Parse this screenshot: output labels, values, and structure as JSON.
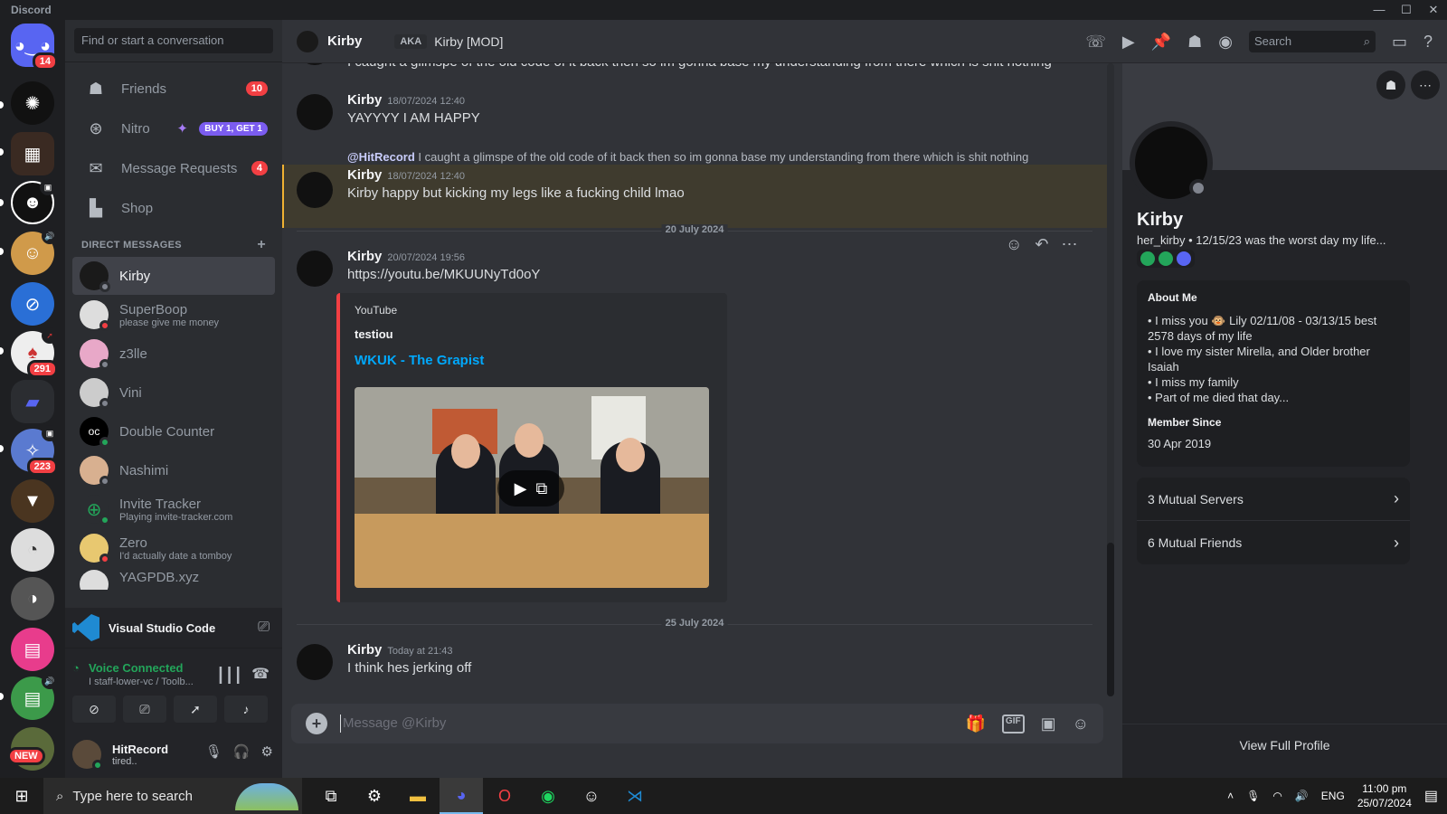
{
  "app": {
    "title": "Discord",
    "window_controls": [
      "—",
      "☐",
      "✕"
    ]
  },
  "servers": {
    "home_badge": "14",
    "badge_291": "291",
    "badge_223": "223",
    "new_label": "NEW"
  },
  "dm_sidebar": {
    "search_placeholder": "Find or start a conversation",
    "nav": [
      {
        "label": "Friends",
        "count": "10"
      },
      {
        "label": "Nitro",
        "promo": "BUY 1, GET 1"
      },
      {
        "label": "Message Requests",
        "count": "4"
      },
      {
        "label": "Shop"
      }
    ],
    "section_title": "DIRECT MESSAGES",
    "add": "+",
    "dms": [
      {
        "name": "Kirby",
        "status": ""
      },
      {
        "name": "SuperBoop",
        "status": "please give me money"
      },
      {
        "name": "z3lle",
        "status": ""
      },
      {
        "name": "Vini",
        "status": ""
      },
      {
        "name": "Double Counter",
        "status": ""
      },
      {
        "name": "Nashimi",
        "status": ""
      },
      {
        "name": "Invite Tracker",
        "status": "Playing invite-tracker.com"
      },
      {
        "name": "Zero",
        "status": "I'd actually date a tomboy"
      },
      {
        "name": "YAGPDB.xyz",
        "status": ""
      }
    ],
    "activity": {
      "name": "Visual Studio Code"
    },
    "voice": {
      "title": "Voice Connected",
      "channel": "I staff-lower-vc / Toolb..."
    },
    "user": {
      "name": "HitRecord",
      "status": "tired.."
    }
  },
  "chat_header": {
    "name": "Kirby",
    "aka_label": "AKA",
    "aka_name": "Kirby [MOD]",
    "search_placeholder": "Search"
  },
  "messages": {
    "partial_top": "I caught a glimspe of the old code of it back then so im gonna base my understanding from there which is shit nothing",
    "m1": {
      "author": "Kirby",
      "time": "18/07/2024 12:40",
      "text": "YAYYYY I AM HAPPY"
    },
    "m2": {
      "reply_mention": "@HitRecord",
      "reply_text": "I caught a glimspe of the old code of it back then so im gonna base my understanding from there which is shit nothing",
      "author": "Kirby",
      "time": "18/07/2024 12:40",
      "text": "Kirby happy but kicking my legs like a fucking child lmao"
    },
    "divider1": "20 July 2024",
    "m3": {
      "author": "Kirby",
      "time": "20/07/2024 19:56",
      "link": "https://youtu.be/MKUUNyTd0oY",
      "embed": {
        "provider": "YouTube",
        "author": "testiou",
        "title": "WKUK - The Grapist"
      }
    },
    "divider2": "25 July 2024",
    "m4": {
      "author": "Kirby",
      "time": "Today at 21:43",
      "text": "I think hes jerking off"
    }
  },
  "composer": {
    "placeholder": "Message @Kirby",
    "gif": "GIF"
  },
  "profile": {
    "name": "Kirby",
    "tagline": "her_kirby • 12/15/23 was the worst day my life...",
    "about_title": "About Me",
    "about_lines": [
      "• I miss you 🐵 Lily 02/11/08 - 03/13/15 best 2578 days of my life",
      "• I love my sister Mirella, and Older brother Isaiah",
      "• I miss my family",
      "• Part of me died that day..."
    ],
    "member_since_title": "Member Since",
    "member_since": "30 Apr 2019",
    "mutual_servers": "3 Mutual Servers",
    "mutual_friends": "6 Mutual Friends",
    "view_full": "View Full Profile"
  },
  "taskbar": {
    "search_placeholder": "Type here to search",
    "lang": "ENG",
    "time": "11:00 pm",
    "date": "25/07/2024"
  }
}
